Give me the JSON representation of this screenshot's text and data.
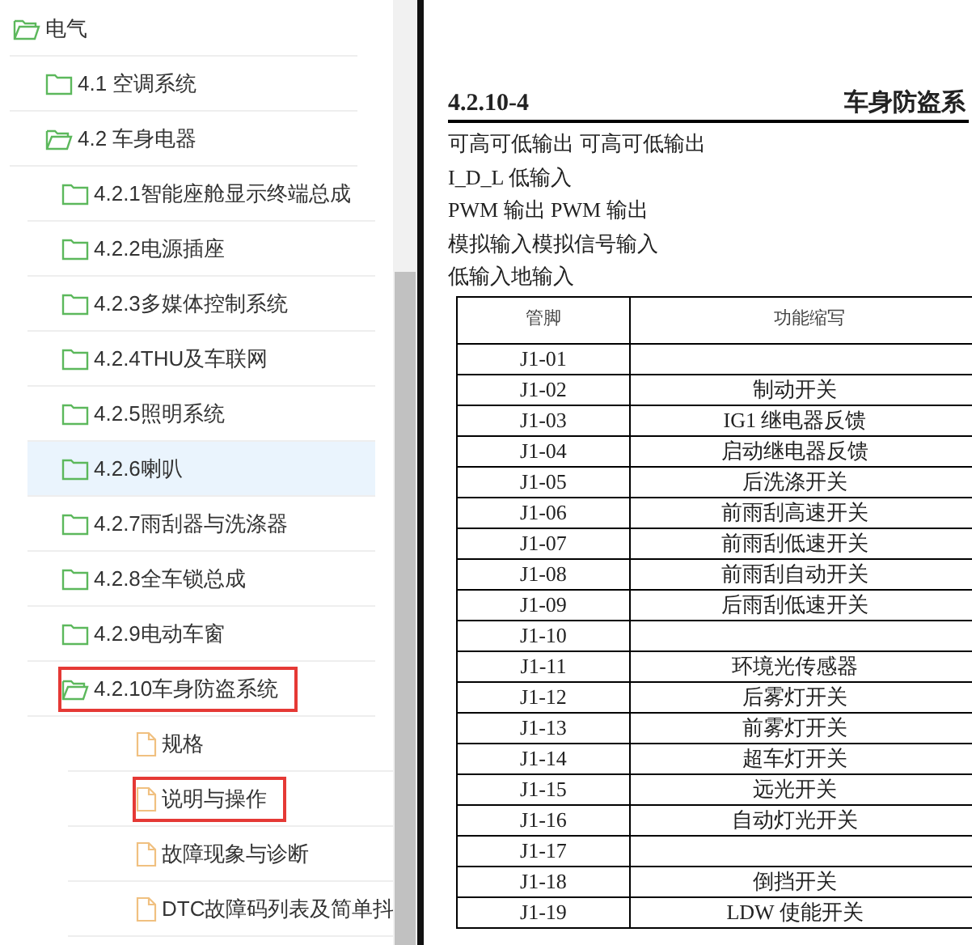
{
  "tree": [
    {
      "label": "电气",
      "kind": "folder",
      "expanded": true,
      "selected": false,
      "outlined": false,
      "children": [
        {
          "label": "4.1 空调系统",
          "kind": "folder",
          "expanded": false,
          "selected": false,
          "outlined": false
        },
        {
          "label": "4.2 车身电器",
          "kind": "folder",
          "expanded": true,
          "selected": false,
          "outlined": false,
          "children": [
            {
              "label": "4.2.1智能座舱显示终端总成",
              "kind": "folder",
              "expanded": false,
              "selected": false,
              "outlined": false
            },
            {
              "label": "4.2.2电源插座",
              "kind": "folder",
              "expanded": false,
              "selected": false,
              "outlined": false
            },
            {
              "label": "4.2.3多媒体控制系统",
              "kind": "folder",
              "expanded": false,
              "selected": false,
              "outlined": false
            },
            {
              "label": "4.2.4THU及车联网",
              "kind": "folder",
              "expanded": false,
              "selected": false,
              "outlined": false
            },
            {
              "label": "4.2.5照明系统",
              "kind": "folder",
              "expanded": false,
              "selected": false,
              "outlined": false
            },
            {
              "label": "4.2.6喇叭",
              "kind": "folder",
              "expanded": false,
              "selected": true,
              "outlined": false
            },
            {
              "label": "4.2.7雨刮器与洗涤器",
              "kind": "folder",
              "expanded": false,
              "selected": false,
              "outlined": false
            },
            {
              "label": "4.2.8全车锁总成",
              "kind": "folder",
              "expanded": false,
              "selected": false,
              "outlined": false
            },
            {
              "label": "4.2.9电动车窗",
              "kind": "folder",
              "expanded": false,
              "selected": false,
              "outlined": false
            },
            {
              "label": "4.2.10车身防盗系统",
              "kind": "folder",
              "expanded": true,
              "selected": false,
              "outlined": true,
              "children": [
                {
                  "label": "规格",
                  "kind": "file",
                  "selected": false,
                  "outlined": false
                },
                {
                  "label": "说明与操作",
                  "kind": "file",
                  "selected": false,
                  "outlined": true
                },
                {
                  "label": "故障现象与诊断",
                  "kind": "file",
                  "selected": false,
                  "outlined": false
                },
                {
                  "label": "DTC故障码列表及简单抖",
                  "kind": "file",
                  "selected": false,
                  "outlined": false
                }
              ]
            }
          ]
        }
      ]
    }
  ],
  "document": {
    "page_number": "4.2.10-4",
    "section_title": "车身防盗系",
    "lines": [
      "可高可低输出 可高可低输出",
      "I_D_L 低输入",
      "PWM 输出 PWM 输出",
      "模拟输入模拟信号输入",
      "低输入地输入"
    ],
    "table": {
      "columns": [
        "管脚",
        "功能缩写"
      ],
      "rows": [
        [
          "J1-01",
          ""
        ],
        [
          "J1-02",
          "制动开关"
        ],
        [
          "J1-03",
          "IG1 继电器反馈"
        ],
        [
          "J1-04",
          "启动继电器反馈"
        ],
        [
          "J1-05",
          "后洗涤开关"
        ],
        [
          "J1-06",
          "前雨刮高速开关"
        ],
        [
          "J1-07",
          "前雨刮低速开关"
        ],
        [
          "J1-08",
          "前雨刮自动开关"
        ],
        [
          "J1-09",
          "后雨刮低速开关"
        ],
        [
          "J1-10",
          ""
        ],
        [
          "J1-11",
          "环境光传感器"
        ],
        [
          "J1-12",
          "后雾灯开关"
        ],
        [
          "J1-13",
          "前雾灯开关"
        ],
        [
          "J1-14",
          "超车灯开关"
        ],
        [
          "J1-15",
          "远光开关"
        ],
        [
          "J1-16",
          "自动灯光开关"
        ],
        [
          "J1-17",
          ""
        ],
        [
          "J1-18",
          "倒挡开关"
        ],
        [
          "J1-19",
          "LDW 使能开关"
        ]
      ]
    }
  }
}
